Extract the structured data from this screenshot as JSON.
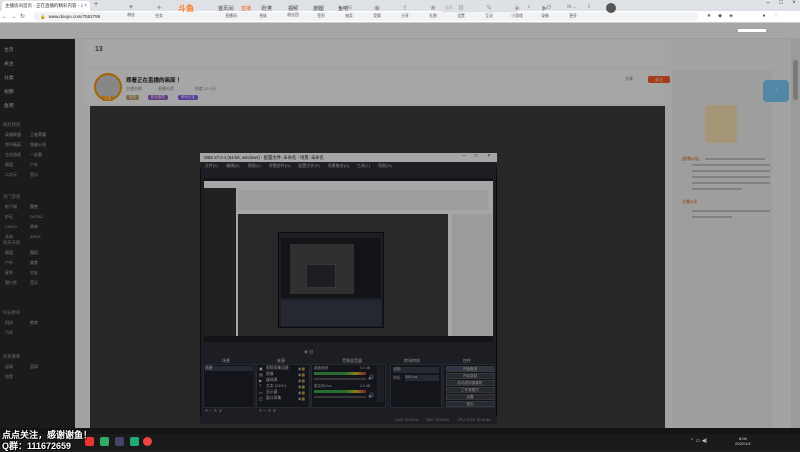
{
  "browser": {
    "tab_title": "主播房间首页 - 正在直播的精彩内容 - 斗鱼直播",
    "url": "www.douyu.com/7553759",
    "new_tab_symbol": "+"
  },
  "site": {
    "logo": "斗鱼",
    "nav": [
      "首页",
      "直播",
      "分类",
      "视频",
      "游戏",
      "鱼吧"
    ],
    "search_placeholder": "搜索"
  },
  "sidebar": {
    "top_items": [
      "主页",
      "关注",
      "分类",
      "视频",
      "鱼吧"
    ],
    "sections": [
      {
        "title": "推荐频道",
        "items": [
          "英雄联盟",
          "王者荣耀",
          "和平精英",
          "穿越火线",
          "主机游戏",
          "一起看",
          "颜值",
          "户外",
          "二次元",
          "音乐"
        ]
      },
      {
        "title": "热门游戏",
        "items": [
          "地下城",
          "魔兽",
          "炉石",
          "DOTA2",
          "CSGO",
          "原神",
          "永劫",
          "APEX"
        ]
      },
      {
        "title": "娱乐天地",
        "items": [
          "颜值",
          "舞蹈",
          "户外",
          "美食",
          "星秀",
          "交友",
          "脱口秀",
          "音乐"
        ]
      },
      {
        "title": "科技教育",
        "items": [
          "科技",
          "教育",
          "汽车"
        ]
      },
      {
        "title": "体育赛事",
        "items": [
          "足球",
          "篮球",
          "电竞"
        ]
      }
    ]
  },
  "room": {
    "tabs": [
      "粉丝",
      "任务",
      "直播间",
      "贵族",
      "粉丝团",
      "签到",
      "抽奖",
      "竞猜",
      "分享",
      "礼物",
      "设置",
      "互动",
      "小游戏",
      "录像",
      "更多"
    ],
    "title": "观看正在直播的画面 ！",
    "host_label": "主播",
    "meta": [
      "主播名称",
      "直播分类",
      "热度 12.3万"
    ],
    "badges": [
      "等级",
      "粉丝徽章",
      "房间认证"
    ],
    "fans_count": "13",
    "share_label": "分享",
    "follow_label": "关注"
  },
  "obs": {
    "title": "OBS 27.0.1 (64-bit, windows) - 配置文件: 未命名 - 场景: 未命名",
    "menu": [
      "文件(F)",
      "编辑(E)",
      "视图(V)",
      "停靠部件(D)",
      "配置文件(P)",
      "场景集合(S)",
      "工具(T)",
      "帮助(H)"
    ],
    "docks": [
      "场景",
      "来源",
      "音频混音器",
      "转场特效",
      "控件"
    ],
    "scenes": [
      "场景"
    ],
    "sources": [
      "视频采集设备",
      "图像",
      "媒体源",
      "文本 (GDI+)",
      "显示器",
      "窗口采集"
    ],
    "mixer": [
      {
        "name": "桌面音频",
        "db": "0.0 dB"
      },
      {
        "name": "麦克风/Aux",
        "db": "0.0 dB"
      }
    ],
    "transition": {
      "type": "淡出",
      "duration_label": "时长",
      "duration": "300 ms"
    },
    "controls": [
      "开始推流",
      "开始录制",
      "启动虚拟摄像机",
      "工作室模式",
      "设置",
      "退出"
    ],
    "status": [
      "LIVE: 00:00:00",
      "REC: 00:00:00",
      "CPU: 3.2%, 30.00 fps"
    ],
    "dock_footer": "+  −  ∧  ∨"
  },
  "overlay": {
    "line1": "点点关注，感谢谢鱼！",
    "line2": "Q群：111672659"
  },
  "system": {
    "time": "8:06",
    "date": "2022/1/4"
  },
  "right_panel": {
    "notice_prefix": "[直播公告]",
    "notice_label": "主播公告"
  },
  "colors": {
    "accent": "#ff5d23",
    "obs_bg": "#2b2e38"
  }
}
